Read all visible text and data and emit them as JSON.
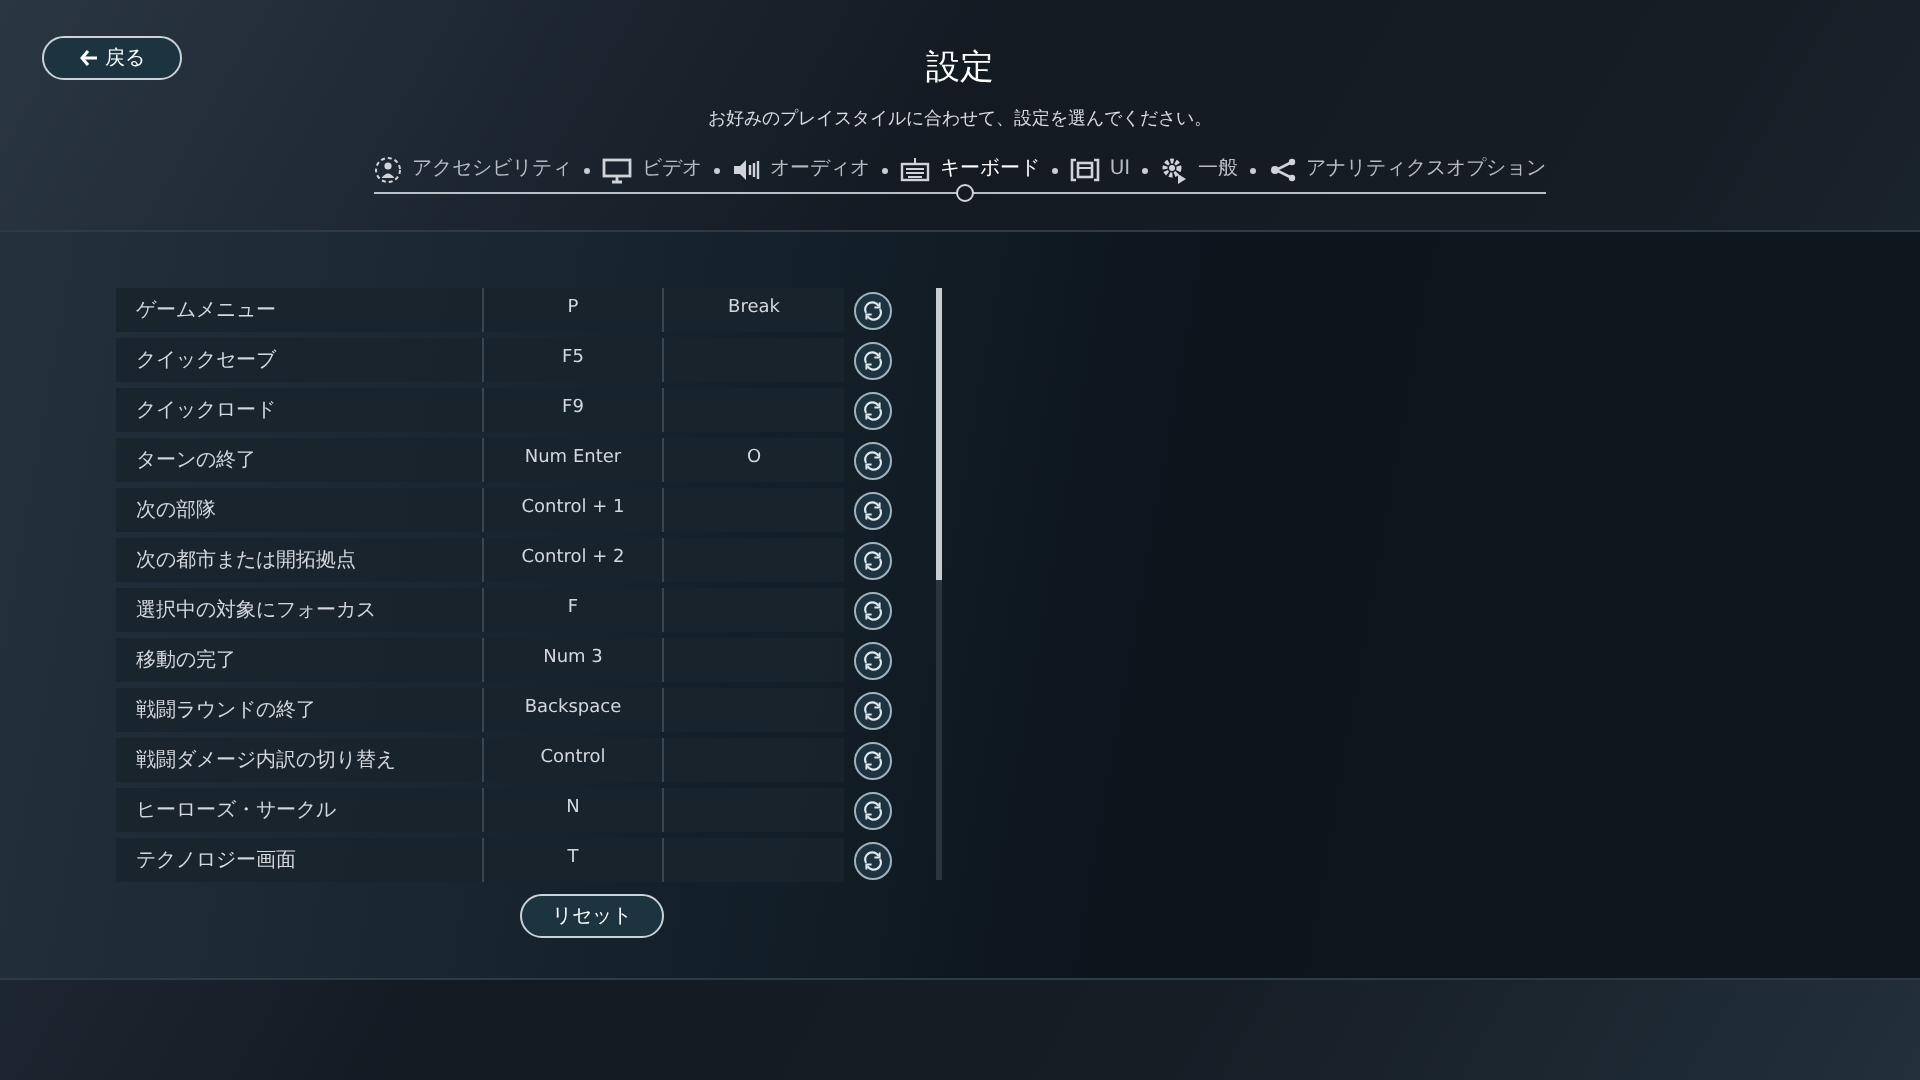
{
  "back_button": {
    "label": "戻る"
  },
  "title": "設定",
  "subtitle": "お好みのプレイスタイルに合わせて、設定を選んでください。",
  "tabs": [
    {
      "kind": "accessibility",
      "label": "アクセシビリティ",
      "selected": false
    },
    {
      "kind": "video",
      "label": "ビデオ",
      "selected": false
    },
    {
      "kind": "audio",
      "label": "オーディオ",
      "selected": false
    },
    {
      "kind": "keyboard",
      "label": "キーボード",
      "selected": true
    },
    {
      "kind": "ui",
      "label": "UI",
      "selected": false
    },
    {
      "kind": "general",
      "label": "一般",
      "selected": false
    },
    {
      "kind": "analytics",
      "label": "アナリティクスオプション",
      "selected": false
    }
  ],
  "bindings": [
    {
      "action": "ゲームメニュー",
      "primary": "P",
      "secondary": "Break"
    },
    {
      "action": "クイックセーブ",
      "primary": "F5"
    },
    {
      "action": "クイックロード",
      "primary": "F9"
    },
    {
      "action": "ターンの終了",
      "primary": "Num Enter",
      "secondary": "O"
    },
    {
      "action": "次の部隊",
      "primary": "Control + 1"
    },
    {
      "action": "次の都市または開拓拠点",
      "primary": "Control + 2"
    },
    {
      "action": "選択中の対象にフォーカス",
      "primary": "F"
    },
    {
      "action": "移動の完了",
      "primary": "Num 3"
    },
    {
      "action": "戦闘ラウンドの終了",
      "primary": "Backspace"
    },
    {
      "action": "戦闘ダメージ内訳の切り替え",
      "primary": "Control"
    },
    {
      "action": "ヒーローズ・サークル",
      "primary": "N"
    },
    {
      "action": "テクノロジー画面",
      "primary": "T"
    }
  ],
  "reset_button": {
    "label": "リセット"
  }
}
